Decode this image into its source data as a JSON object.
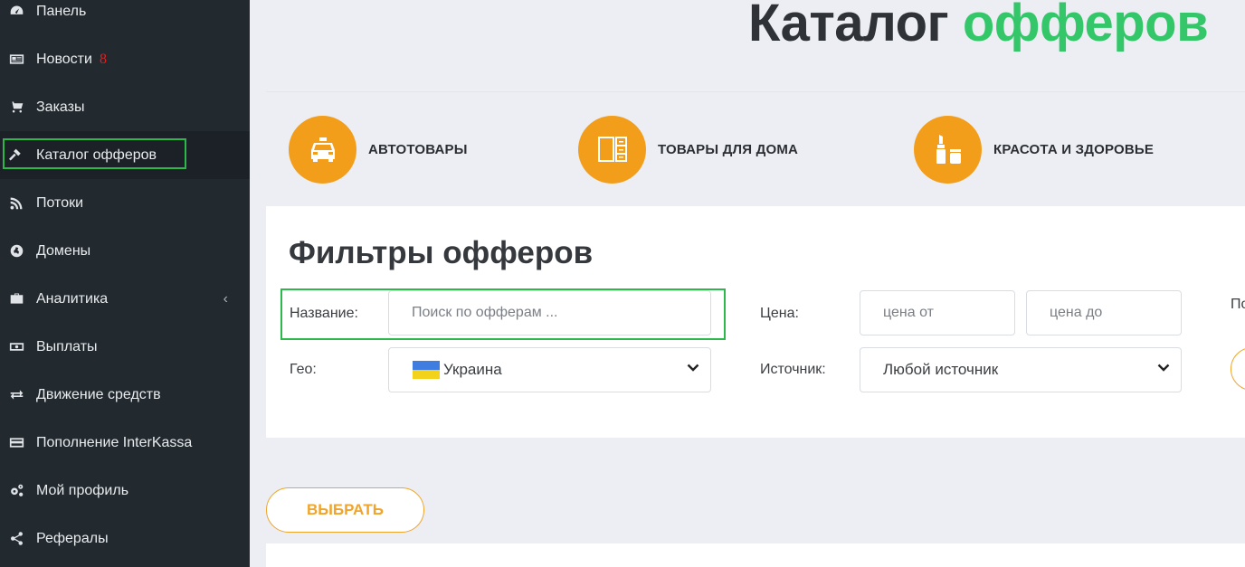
{
  "sidebar": {
    "items": [
      {
        "label": "Панель",
        "icon": "dashboard-icon"
      },
      {
        "label": "Новости",
        "icon": "newspaper-icon",
        "badge": "8"
      },
      {
        "label": "Заказы",
        "icon": "cart-icon"
      },
      {
        "label": "Каталог офферов",
        "icon": "gavel-icon",
        "active": true
      },
      {
        "label": "Потоки",
        "icon": "rss-icon"
      },
      {
        "label": "Домены",
        "icon": "globe-icon"
      },
      {
        "label": "Аналитика",
        "icon": "briefcase-icon",
        "expandable": true
      },
      {
        "label": "Выплаты",
        "icon": "money-icon"
      },
      {
        "label": "Движение средств",
        "icon": "exchange-icon"
      },
      {
        "label": "Пополнение InterKassa",
        "icon": "credit-card-icon"
      },
      {
        "label": "Мой профиль",
        "icon": "gears-icon"
      },
      {
        "label": "Рефералы",
        "icon": "share-icon"
      }
    ],
    "chevron": "‹"
  },
  "header": {
    "title_part1": "Каталог",
    "title_part2": "офферов"
  },
  "categories": [
    {
      "label": "АВТОТОВАРЫ",
      "icon": "taxi-icon"
    },
    {
      "label": "ТОВАРЫ ДЛЯ ДОМА",
      "icon": "cabinet-icon"
    },
    {
      "label": "КРАСОТА И ЗДОРОВЬЕ",
      "icon": "lipstick-icon"
    }
  ],
  "filters": {
    "title": "Фильтры офферов",
    "name_label": "Название:",
    "name_placeholder": "Поиск по офферам ...",
    "price_label": "Цена:",
    "price_from_placeholder": "цена от",
    "price_to_placeholder": "цена до",
    "truncated_label": "По",
    "geo_label": "Гео:",
    "geo_value": "Украина",
    "source_label": "Источник:",
    "source_value": "Любой источник"
  },
  "actions": {
    "select_label": "ВЫБРАТЬ"
  },
  "colors": {
    "sidebar_bg": "#22292f",
    "accent_green": "#34c76a",
    "accent_orange": "#f29e1b",
    "highlight_green": "#2db84c",
    "badge_red": "#e02020"
  }
}
